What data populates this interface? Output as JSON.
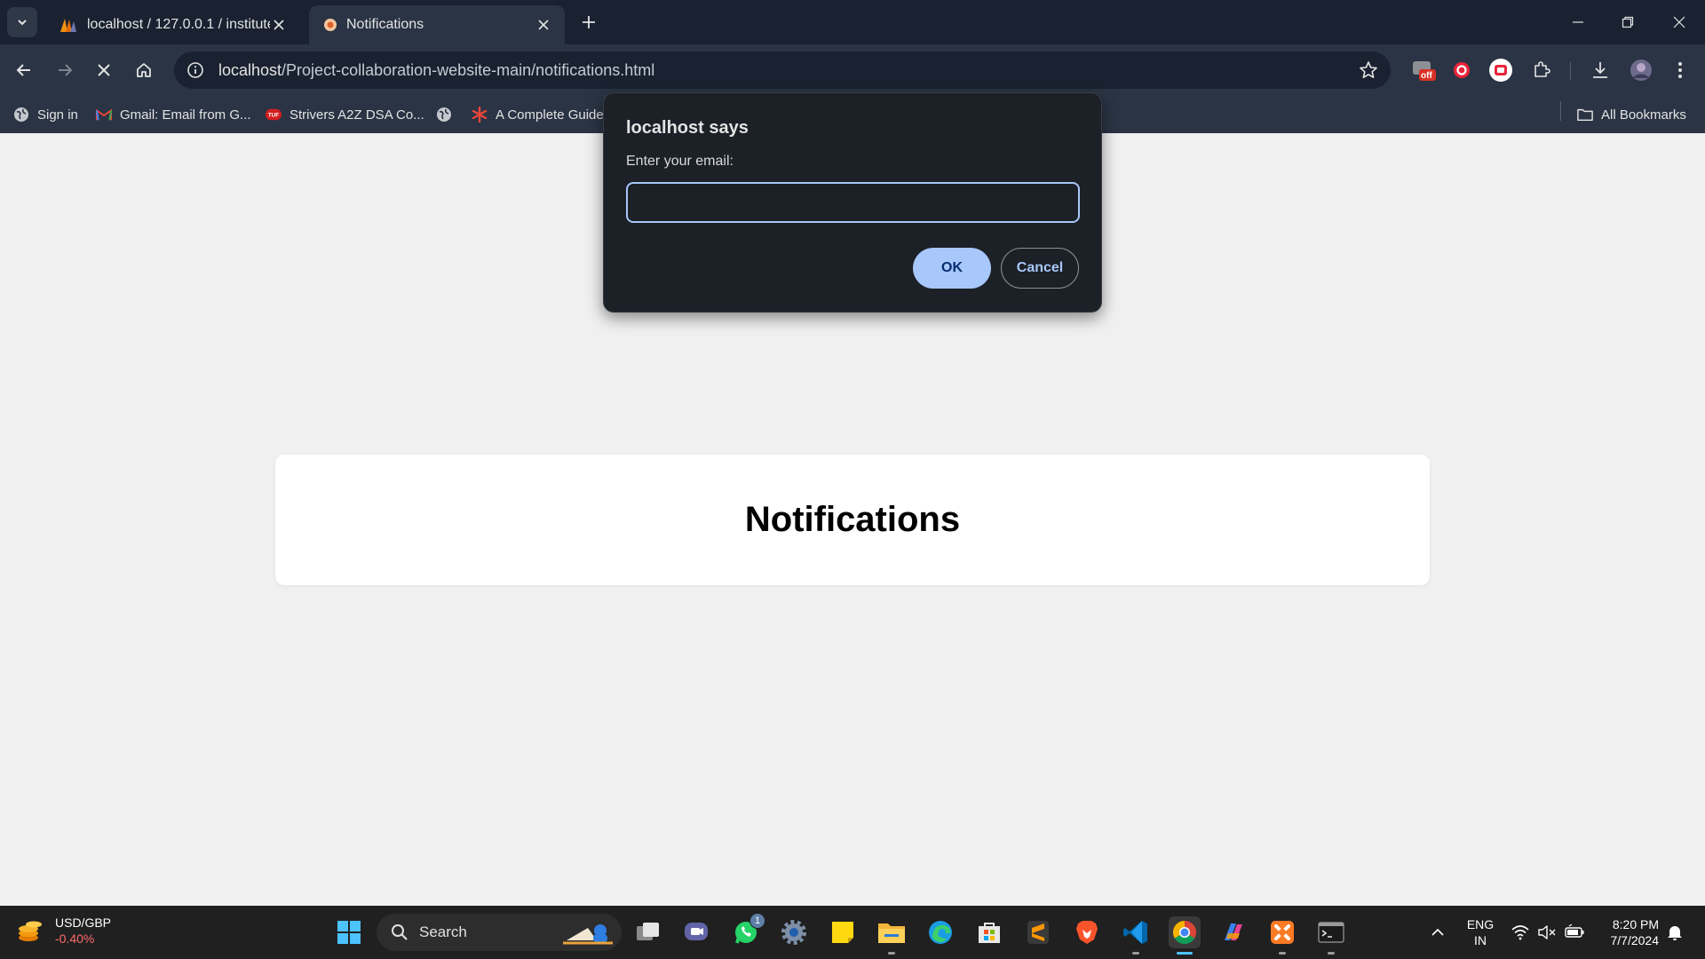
{
  "browser": {
    "tabs": [
      {
        "title": "localhost / 127.0.0.1 / institute_",
        "icon": "phpmyadmin-icon",
        "active": false
      },
      {
        "title": "Notifications",
        "icon": "page-favicon-icon",
        "active": true
      }
    ],
    "omnibox": {
      "host": "localhost",
      "path": "/Project-collaboration-website-main/notifications.html"
    },
    "extension_badge": "off",
    "bookmarks": [
      {
        "label": "Sign in",
        "icon": "globe-icon"
      },
      {
        "label": "Gmail: Email from G...",
        "icon": "gmail-icon"
      },
      {
        "label": "Strivers A2Z DSA Co...",
        "icon": "tuf-icon"
      },
      {
        "label": "",
        "icon": "globe-icon"
      },
      {
        "label": "A Complete Guide",
        "icon": "asterisk-icon"
      }
    ],
    "all_bookmarks_label": "All Bookmarks"
  },
  "dialog": {
    "title": "localhost says",
    "message": "Enter your email:",
    "input_value": "",
    "ok_label": "OK",
    "cancel_label": "Cancel"
  },
  "page": {
    "heading": "Notifications"
  },
  "taskbar": {
    "widget": {
      "pair": "USD/GBP",
      "change": "-0.40%"
    },
    "search_label": "Search",
    "whatsapp_badge": "1",
    "language": {
      "line1": "ENG",
      "line2": "IN"
    },
    "clock": {
      "time": "8:20 PM",
      "date": "7/7/2024"
    }
  },
  "colors": {
    "tab_strip": "#1a2231",
    "toolbar": "#2a3444",
    "dialog_bg": "#1c2027",
    "accent": "#a8c7fa",
    "page_bg": "#f0f0f0"
  }
}
